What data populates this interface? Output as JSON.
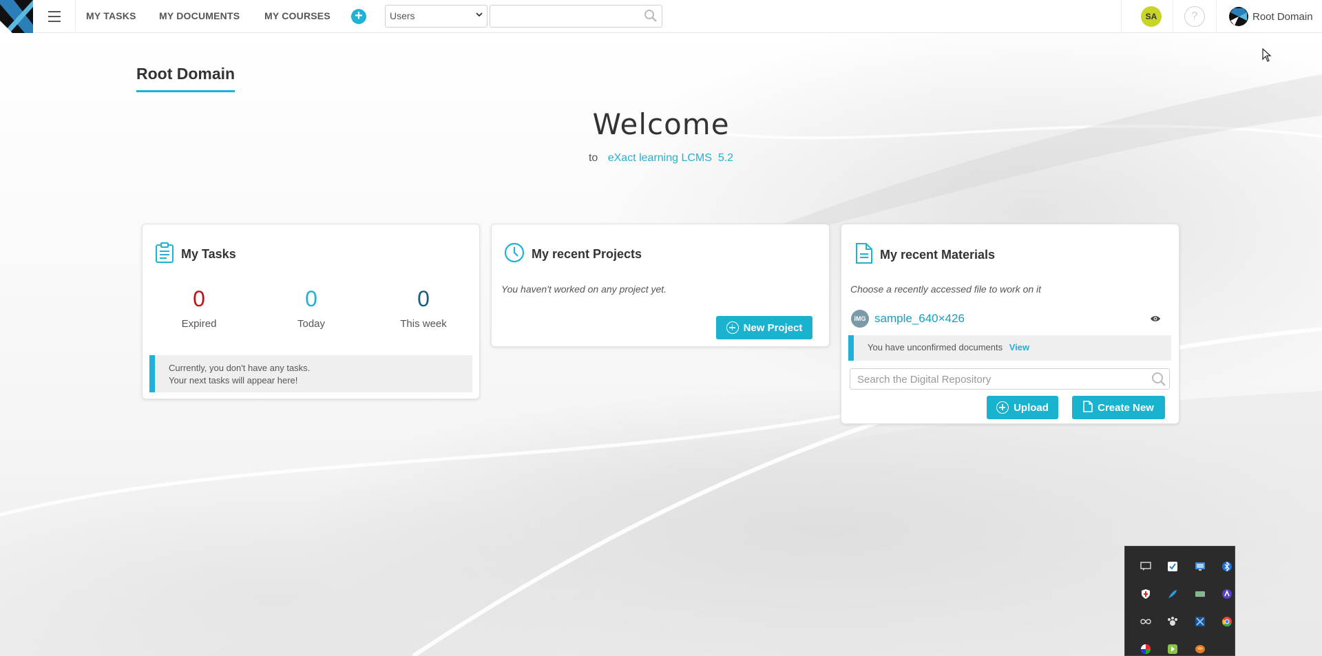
{
  "topbar": {
    "nav": [
      {
        "label": "MY TASKS"
      },
      {
        "label": "MY DOCUMENTS"
      },
      {
        "label": "MY COURSES"
      }
    ],
    "add_icon": "plus-circle-icon",
    "entity_select": {
      "selected": "Users"
    },
    "search": {
      "value": "",
      "placeholder": ""
    },
    "avatar_initials": "SA",
    "help_icon": "?",
    "domain_label": "Root Domain"
  },
  "main": {
    "domain_title": "Root Domain",
    "welcome_title": "Welcome",
    "welcome_to": "to",
    "product_name": "eXact learning LCMS",
    "product_version": "5.2"
  },
  "tasks_card": {
    "title": "My Tasks",
    "icon": "clipboard-icon",
    "stats": [
      {
        "value": "0",
        "label": "Expired",
        "color": "#c0111a"
      },
      {
        "value": "0",
        "label": "Today",
        "color": "#20b2d6"
      },
      {
        "value": "0",
        "label": "This week",
        "color": "#1a5c80"
      }
    ],
    "notice_line1": "Currently, you don't have any tasks.",
    "notice_line2": "Your next tasks will appear here!"
  },
  "projects_card": {
    "title": "My recent Projects",
    "icon": "clock-icon",
    "empty_text": "You haven't worked on any project yet.",
    "new_project_label": "New Project"
  },
  "materials_card": {
    "title": "My recent Materials",
    "icon": "document-icon",
    "hint": "Choose a recently accessed file to work on it",
    "file": {
      "badge": "IMG",
      "name": "sample_640×426"
    },
    "notice_text": "You have unconfirmed documents",
    "notice_link": "View",
    "search_placeholder": "Search the Digital Repository",
    "upload_label": "Upload",
    "create_label": "Create New"
  },
  "tray": {
    "icons": [
      "chat-icon",
      "shield-check-icon",
      "monitor-icon",
      "bluetooth-icon",
      "security-shield-icon",
      "feather-icon",
      "device-icon",
      "app-purple-icon",
      "infinity-icon",
      "paw-icon",
      "x-app-icon",
      "chrome-icon",
      "color-wheel-icon",
      "green-app-icon",
      "orange-app-icon"
    ]
  },
  "colors": {
    "accent": "#20b2d6",
    "button": "#19b2cf",
    "expired": "#c0111a"
  }
}
